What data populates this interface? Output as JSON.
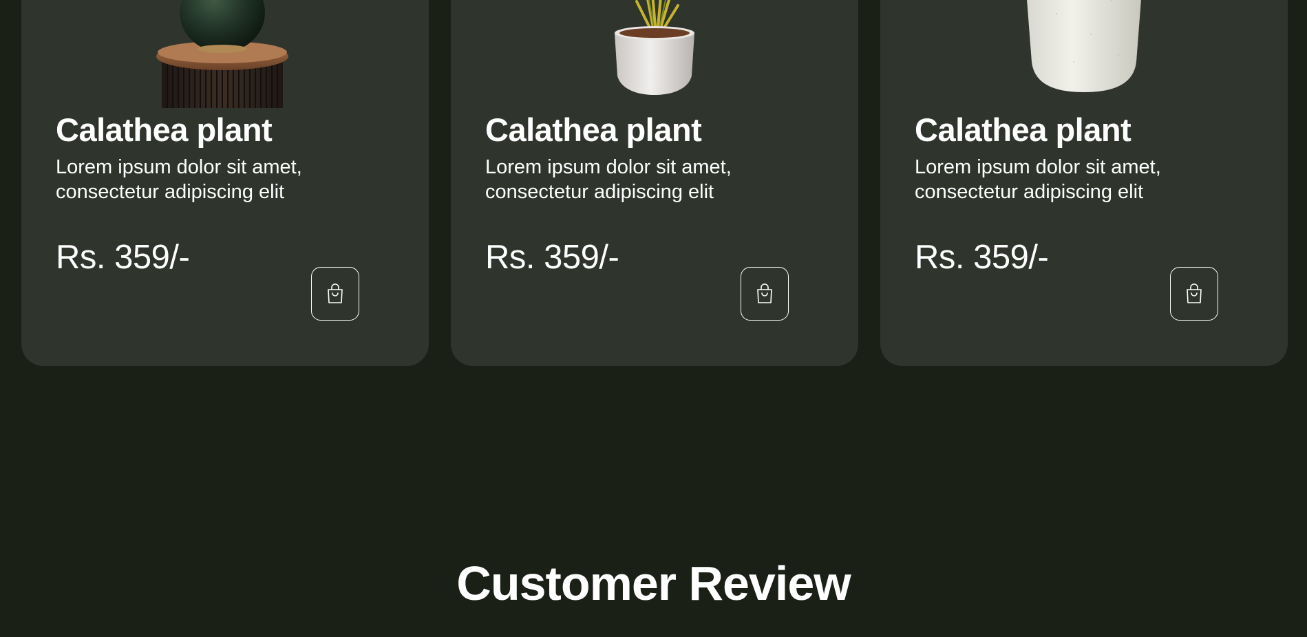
{
  "products": [
    {
      "name": "Calathea plant",
      "description": "Lorem ipsum dolor sit amet, consectetur adipiscing elit",
      "price": "Rs. 359/-",
      "image_icon": "vase-on-table-image",
      "cart_icon": "shopping-bag-icon"
    },
    {
      "name": "Calathea plant",
      "description": "Lorem ipsum dolor sit amet, consectetur adipiscing elit",
      "price": "Rs. 359/-",
      "image_icon": "potted-plant-image",
      "cart_icon": "shopping-bag-icon"
    },
    {
      "name": "Calathea plant",
      "description": "Lorem ipsum dolor sit amet, consectetur adipiscing elit",
      "price": "Rs. 359/-",
      "image_icon": "white-pot-image",
      "cart_icon": "shopping-bag-icon"
    }
  ],
  "reviews": {
    "title": "Customer Review"
  },
  "colors": {
    "page_background": "#1b2017",
    "card_background": "#2f352c",
    "text": "#ffffff"
  }
}
